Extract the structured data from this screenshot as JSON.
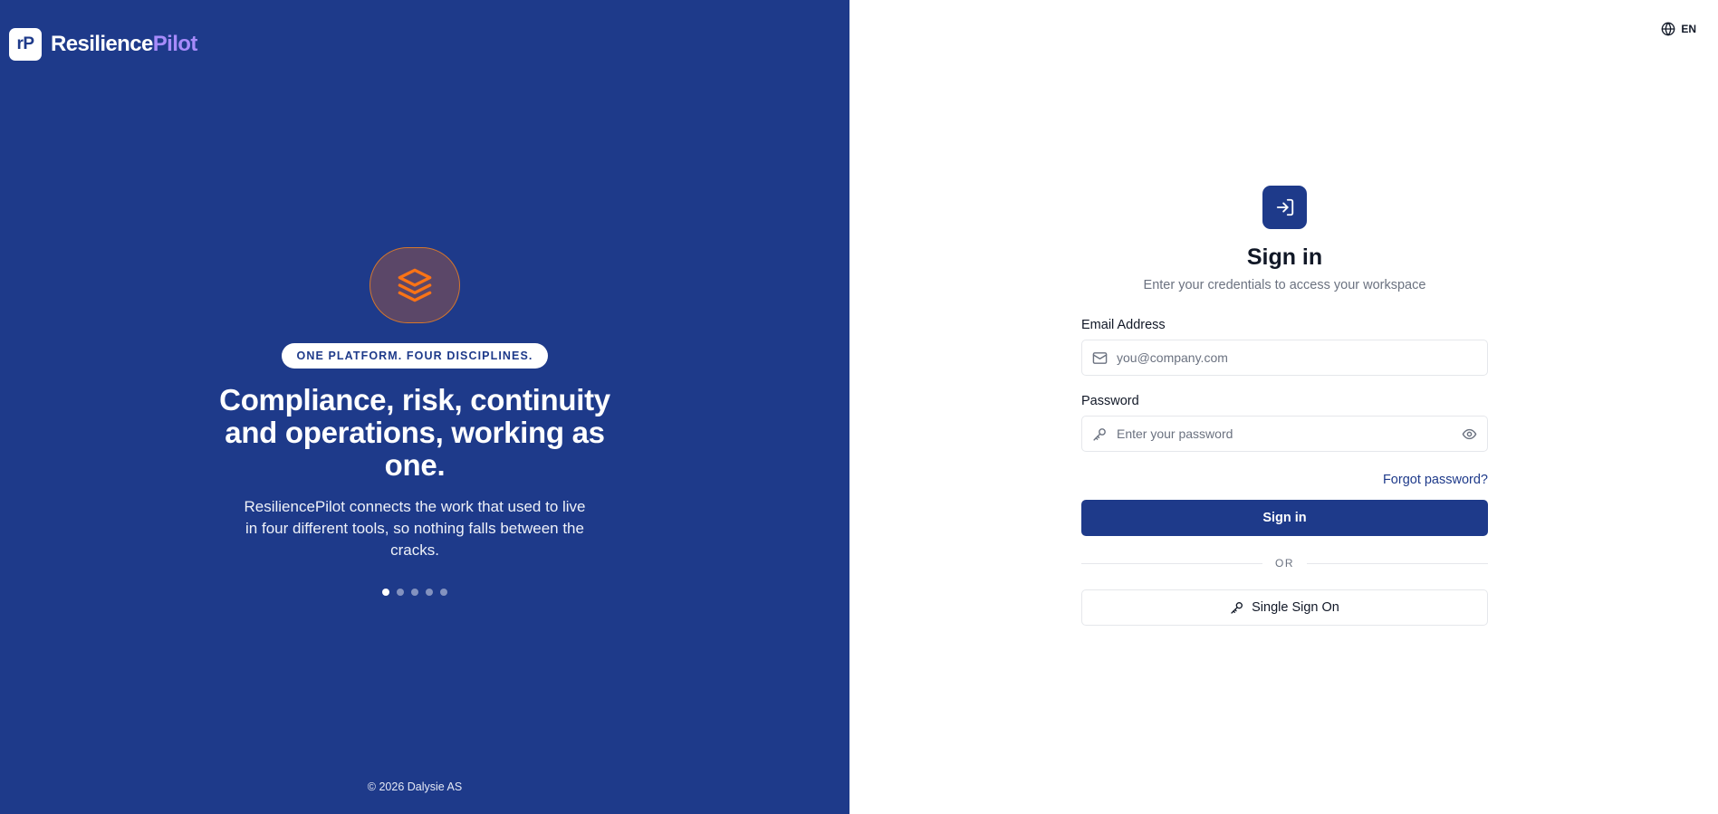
{
  "brand": {
    "logo_text": "rP",
    "name_primary": "Resilience",
    "name_accent": "Pilot"
  },
  "hero": {
    "icon": "layers-icon",
    "badge": "ONE PLATFORM. FOUR DISCIPLINES.",
    "title": "Compliance, risk, continuity and operations, working as one.",
    "description": "ResiliencePilot connects the work that used to live in four different tools, so nothing falls between the cracks.",
    "slides_total": 5,
    "active_slide": 1
  },
  "footer": {
    "copyright": "© 2026 Dalysie AS"
  },
  "language": {
    "icon": "globe-icon",
    "code": "EN"
  },
  "signin": {
    "icon": "sign-in-icon",
    "title": "Sign in",
    "subtitle": "Enter your credentials to access your workspace",
    "email_label": "Email Address",
    "email_placeholder": "you@company.com",
    "password_label": "Password",
    "password_placeholder": "Enter your password",
    "forgot_label": "Forgot password?",
    "submit_label": "Sign in",
    "divider_label": "OR",
    "sso_label": "Single Sign On"
  },
  "colors": {
    "primary": "#1e3a8a",
    "brand_accent": "#a78bfa",
    "hero_icon_accent": "#f97316"
  }
}
